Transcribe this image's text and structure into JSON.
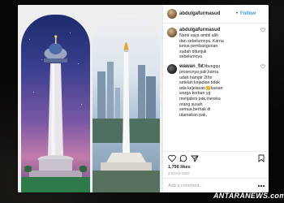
{
  "post": {
    "author": {
      "username": "abdulgafurmasud",
      "follow_label": "Follow"
    },
    "comments": [
      {
        "username": "abdulgafurmasud",
        "lines": [
          "Nanti saya ambil alih",
          "dan sebelumnya. Karna",
          "ketua pembangunan",
          "sudah ditunjuk",
          "sebelumnya"
        ]
      },
      {
        "username": "wawan_fir",
        "lines": [
          "Dibungqu",
          "prosesnya pak,karna",
          "udah hampir 2thn",
          "setelah kejadian tidak",
          "ada kejelasan",
          "kasian",
          "warga korban yg",
          "menjaleni pak,mereka",
          "orang susah",
          "semua,berhak di",
          "utamakan pak,"
        ]
      }
    ],
    "likes": "1,796 likes",
    "time_ago": "2 DAYS AGO",
    "add_comment_placeholder": "Add a comment..."
  },
  "watermark": "ANTARANEWS.com",
  "colors": {
    "accent": "#3897f0",
    "text": "#262626",
    "muted": "#8e8e8e"
  },
  "icons": [
    "heart-icon",
    "comment-icon",
    "share-icon",
    "bookmark-icon",
    "more-options-icon"
  ]
}
